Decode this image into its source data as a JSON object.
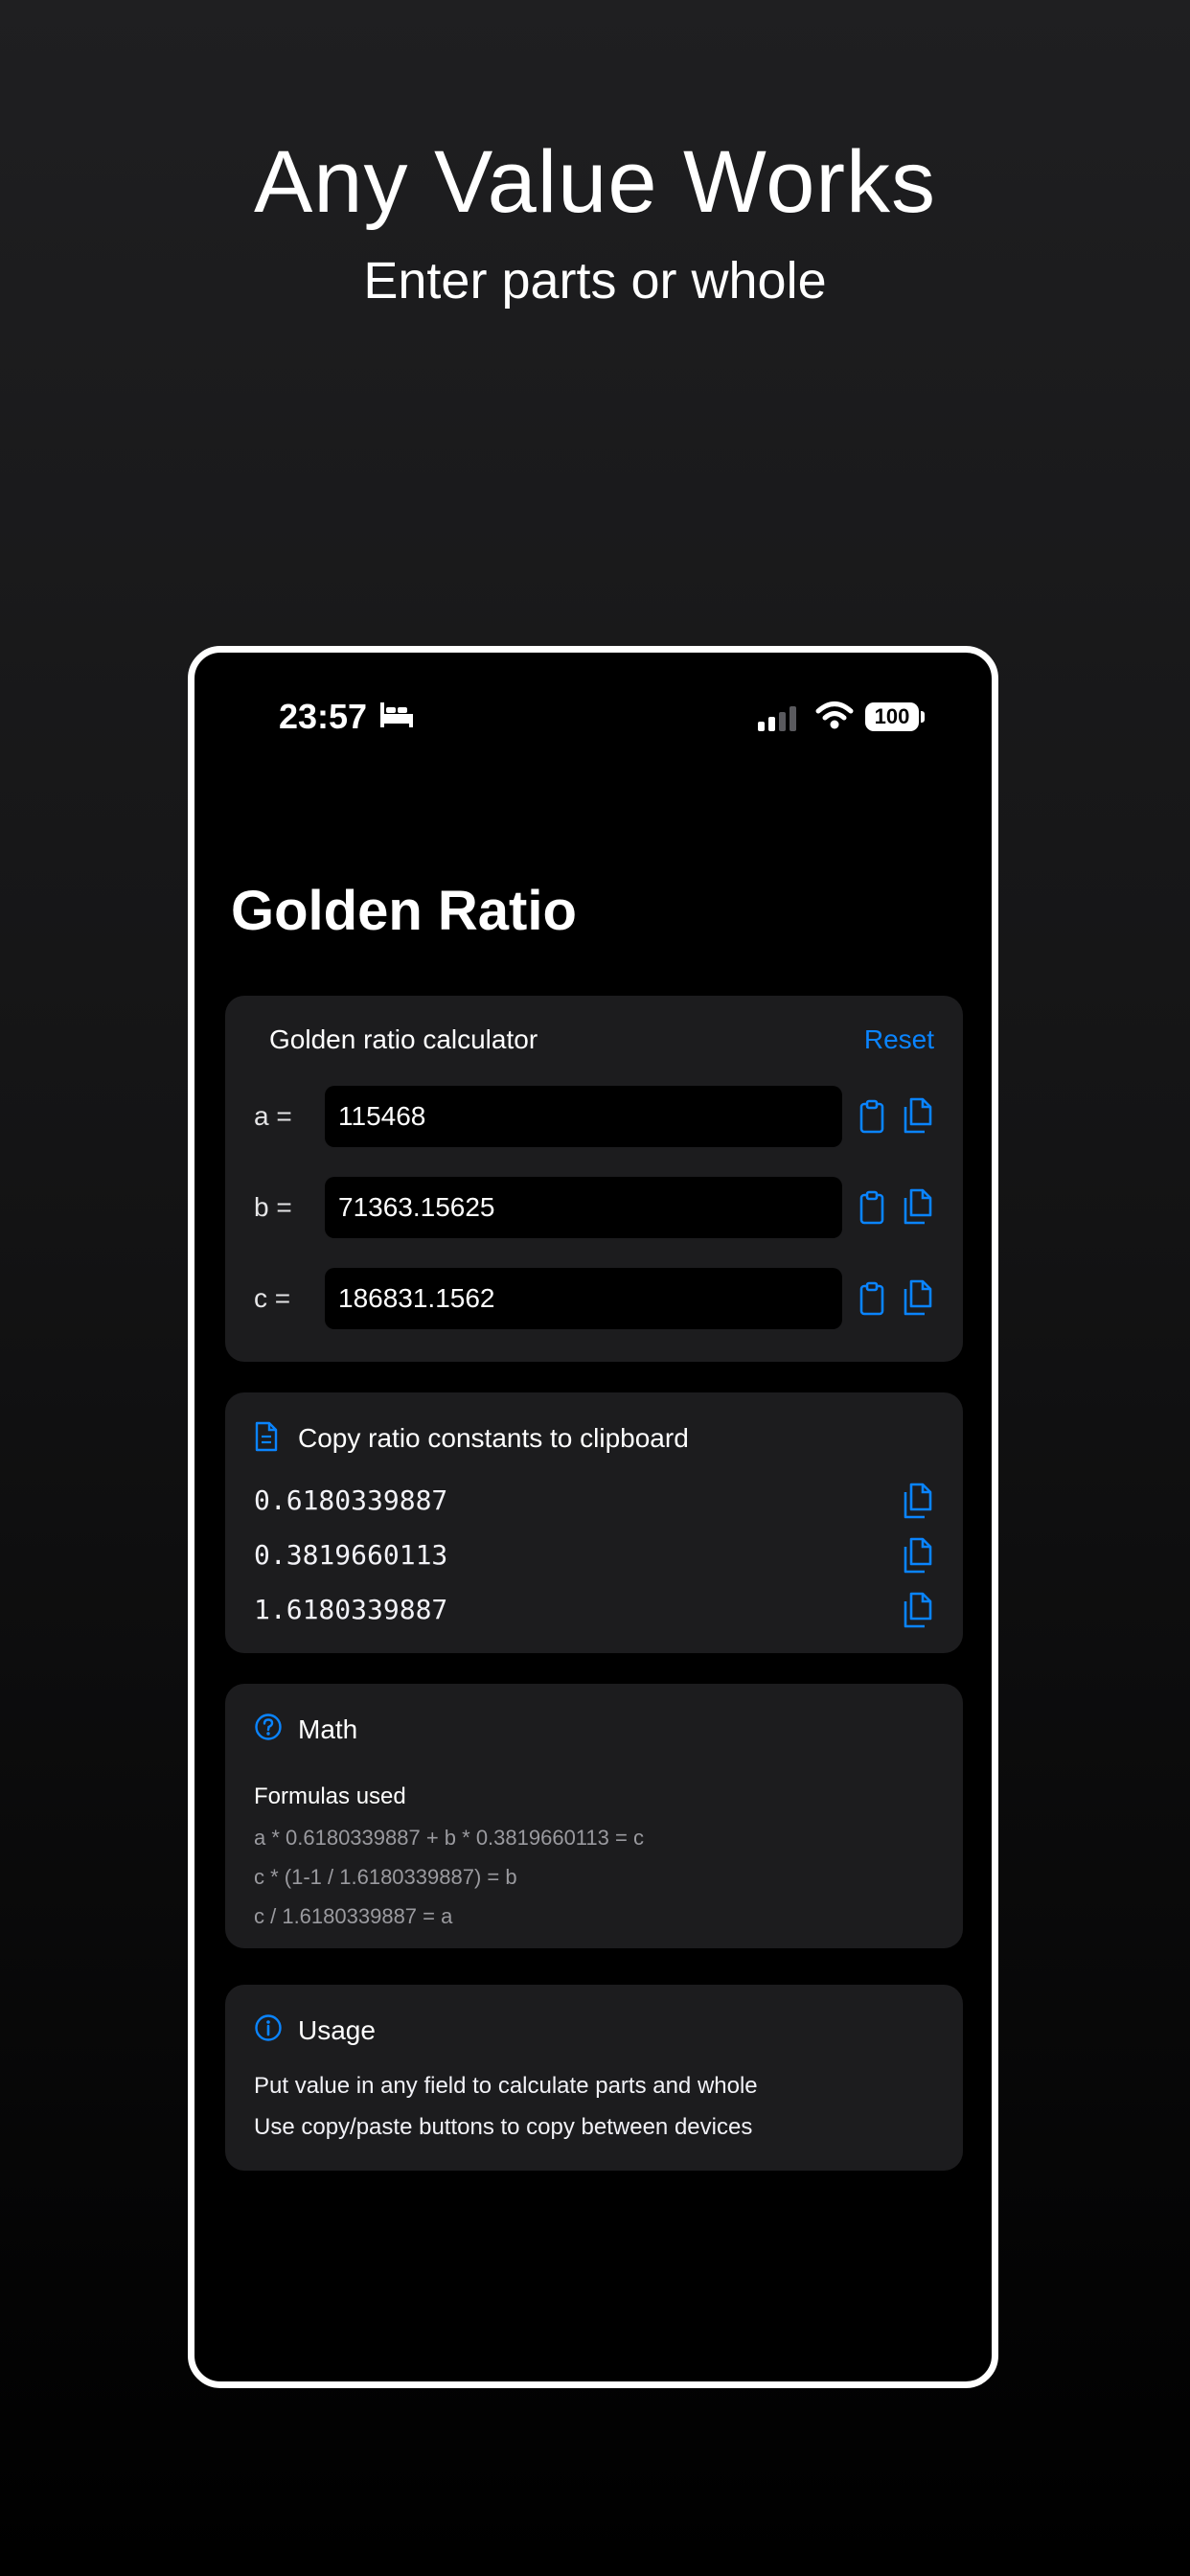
{
  "hero": {
    "title": "Any Value Works",
    "subtitle": "Enter parts or whole"
  },
  "status_bar": {
    "time": "23:57",
    "battery": "100",
    "icons": [
      "bed-icon",
      "signal-icon",
      "wifi-icon",
      "battery-icon"
    ]
  },
  "app": {
    "title": "Golden Ratio"
  },
  "calculator": {
    "header": "Golden ratio calculator",
    "reset_label": "Reset",
    "fields": [
      {
        "label": "a =",
        "value": "115468"
      },
      {
        "label": "b =",
        "value": "71363.15625"
      },
      {
        "label": "c =",
        "value": "186831.1562"
      }
    ]
  },
  "constants": {
    "header": "Copy ratio constants to clipboard",
    "values": [
      "0.6180339887",
      "0.3819660113",
      "1.6180339887"
    ]
  },
  "math": {
    "header": "Math",
    "subheader": "Formulas used",
    "formulas": [
      "a * 0.6180339887 + b * 0.3819660113 = c",
      "c * (1-1 / 1.6180339887) = b",
      "c / 1.6180339887 = a"
    ]
  },
  "usage": {
    "header": "Usage",
    "lines": [
      "Put value in any field to calculate parts and whole",
      "Use copy/paste buttons to copy between devices"
    ]
  },
  "colors": {
    "accent": "#0a84ff",
    "card_background": "#1c1c1e",
    "screen_background": "#000000"
  }
}
